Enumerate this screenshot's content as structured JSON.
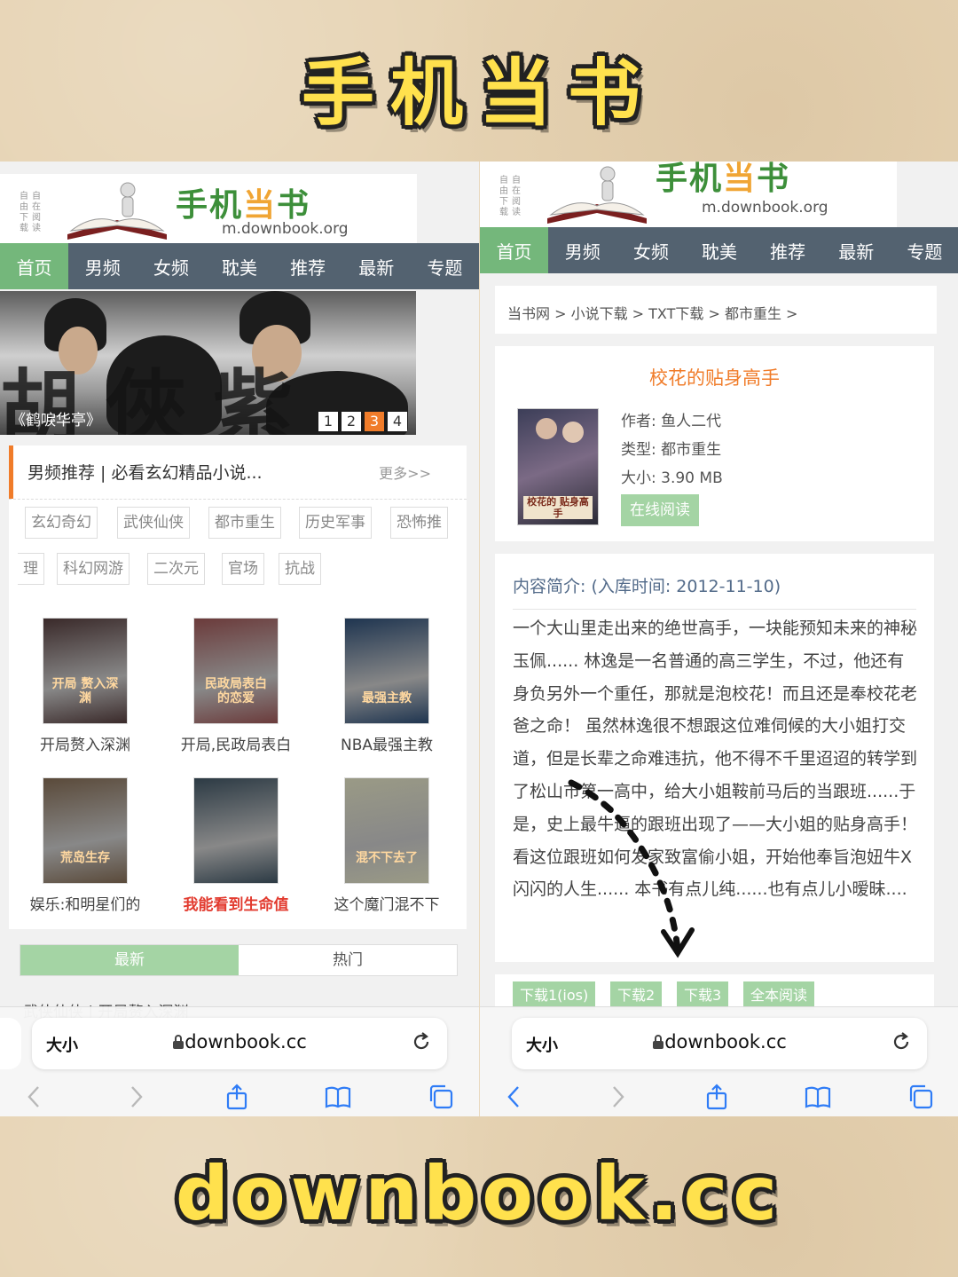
{
  "headline_top": "手机当书",
  "headline_bottom": "downbook.cc",
  "site": {
    "side_tags": [
      [
        "自",
        "由",
        "下",
        "载"
      ],
      [
        "自",
        "在",
        "阅",
        "读"
      ]
    ],
    "logo_title_a": "手机",
    "logo_title_b": "当",
    "logo_title_c": "书",
    "logo_url": "m.downbook.org",
    "nav": [
      "首页",
      "男频",
      "女频",
      "耽美",
      "推荐",
      "最新",
      "专题"
    ]
  },
  "left": {
    "banner_caption": "《鹤唳华亭》",
    "banner_callig": "胡俠紫直",
    "pager": [
      "1",
      "2",
      "3",
      "4"
    ],
    "pager_active": 2,
    "section_title": "男频推荐 | 必看玄幻精品小说...",
    "section_more": "更多>>",
    "tags_row1": [
      "玄幻奇幻",
      "武侠仙侠",
      "都市重生",
      "历史军事",
      "恐怖推"
    ],
    "tags_row2": [
      "理",
      "科幻网游",
      "二次元",
      "官场",
      "抗战"
    ],
    "books": [
      {
        "title": "开局赘入深渊",
        "cover_text": "开局 赘入深渊",
        "bg": "#3a2a2a"
      },
      {
        "title": "开局,民政局表白",
        "cover_text": "民政局表白 的恋爱",
        "bg": "#6b3b3b"
      },
      {
        "title": "NBA最强主教",
        "cover_text": "最强主教",
        "bg": "#1f3550"
      },
      {
        "title": "娱乐:和明星们的",
        "cover_text": "荒岛生存",
        "bg": "#5a4a3a"
      },
      {
        "title": "我能看到生命值",
        "cover_text": "",
        "bg": "#2c3a44"
      },
      {
        "title": "这个魔门混不下",
        "cover_text": "混不下去了",
        "bg": "#9a9a86"
      }
    ],
    "tabs": [
      "最新",
      "热门"
    ],
    "peek_text": "武侠仙侠 | 开局赘入深渊",
    "url_size": "大小",
    "url_domain": "downbook.cc"
  },
  "right": {
    "breadcrumb": "当书网 > 小说下载 > TXT下载 > 都市重生 >",
    "book_title": "校花的贴身高手",
    "cover_text": "校花的 贴身高手",
    "author_label": "作者:",
    "author": "鱼人二代",
    "type_label": "类型:",
    "type": "都市重生",
    "size_label": "大小:",
    "size": "3.90 MB",
    "read_online": "在线阅读",
    "intro_heading": "内容简介: (入库时间: 2012-11-10)",
    "intro_body": "一个大山里走出来的绝世高手，一块能预知未来的神秘玉佩...... 林逸是一名普通的高三学生，不过，他还有身负另外一个重任，那就是泡校花！而且还是奉校花老爸之命！ 虽然林逸很不想跟这位难伺候的大小姐打交道，但是长辈之命难违抗，他不得不千里迢迢的转学到了松山市第一高中，给大小姐鞍前马后的当跟班......于是，史上最牛逼的跟班出现了——大小姐的贴身高手！ 看这位跟班如何发家致富偷小姐，开始他奉旨泡妞牛X闪闪的人生...... 本书有点儿纯......也有点儿小暧昧....",
    "downloads": [
      "下载1(ios)",
      "下载2",
      "下载3",
      "全本阅读"
    ],
    "url_size": "大小",
    "url_domain": "downbook.cc"
  },
  "colors": {
    "nav_bg": "#536270",
    "nav_active": "#74b77b",
    "accent_orange": "#f07c2a",
    "button_green": "#a4d4a4",
    "headline_yellow": "#ffe14d"
  },
  "icons": [
    "lock-icon",
    "reload-icon",
    "back-icon",
    "forward-icon",
    "share-icon",
    "bookmarks-icon",
    "tabs-icon"
  ]
}
